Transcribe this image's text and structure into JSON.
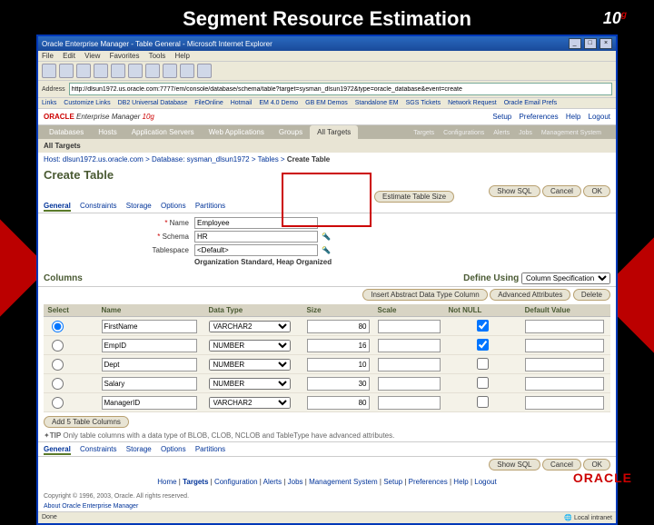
{
  "slide_title": "Segment Resource Estimation",
  "brand_10g": "10",
  "browser": {
    "title": "Oracle Enterprise Manager - Table General - Microsoft Internet Explorer",
    "menu": [
      "File",
      "Edit",
      "View",
      "Favorites",
      "Tools",
      "Help"
    ],
    "addr_label": "Address",
    "addr_url": "http://dlsun1972.us.oracle.com:7777/em/console/database/schema/table?target=sysman_dlsun1972&type=oracle_database&event=create",
    "links_label": "Links",
    "links": [
      "Customize Links",
      "DB2 Universal Database",
      "FileOnline",
      "Hotmail",
      "EM 4.0 Demo",
      "GB EM Demos",
      "Standalone EM",
      "SGS Tickets",
      "Network Request",
      "Oracle Email Prefs"
    ]
  },
  "em": {
    "brand": "ORACLE",
    "product": "Enterprise Manager",
    "ver": "10g",
    "header_links": [
      "Setup",
      "Preferences",
      "Help",
      "Logout"
    ],
    "nav": [
      "Databases",
      "Hosts",
      "Application Servers",
      "Web Applications",
      "Groups"
    ],
    "nav_active": "All Targets",
    "nav_right": [
      "Configurations",
      "Alerts",
      "Jobs",
      "Management System"
    ],
    "subtab_label": "Targets",
    "breadcrumb": {
      "host": "Host: dlsun1972.us.oracle.com",
      "db": "Database: sysman_dlsun1972",
      "tables": "Tables",
      "current": "Create Table"
    }
  },
  "page_title": "Create Table",
  "actions": {
    "show_sql": "Show SQL",
    "cancel": "Cancel",
    "ok": "OK"
  },
  "tabs": [
    "General",
    "Constraints",
    "Storage",
    "Options",
    "Partitions"
  ],
  "form": {
    "name_label": "Name",
    "name_value": "Employee",
    "schema_label": "Schema",
    "schema_value": "HR",
    "ts_label": "Tablespace",
    "ts_value": "<Default>",
    "org_label": "Organization",
    "org_value": "Standard, Heap Organized",
    "lookup_icon": "🔦",
    "estimate": "Estimate Table Size"
  },
  "columns_title": "Columns",
  "define": {
    "label": "Define Using",
    "value": "Column Specification"
  },
  "col_actions": {
    "insert_abs": "Insert Abstract Data Type Column",
    "advanced": "Advanced Attributes",
    "delete": "Delete"
  },
  "headers": {
    "select": "Select",
    "name": "Name",
    "datatype": "Data Type",
    "size": "Size",
    "scale": "Scale",
    "notnull": "Not NULL",
    "default": "Default Value"
  },
  "rows": [
    {
      "name": "FirstName",
      "type": "VARCHAR2",
      "size": "80",
      "scale": "",
      "notnull": true
    },
    {
      "name": "EmpID",
      "type": "NUMBER",
      "size": "16",
      "scale": "",
      "notnull": true
    },
    {
      "name": "Dept",
      "type": "NUMBER",
      "size": "10",
      "scale": "",
      "notnull": false
    },
    {
      "name": "Salary",
      "type": "NUMBER",
      "size": "30",
      "scale": "",
      "notnull": false
    },
    {
      "name": "ManagerID",
      "type": "VARCHAR2",
      "size": "80",
      "scale": "",
      "notnull": false
    }
  ],
  "add5": "Add 5 Table Columns",
  "tip": {
    "label": "TIP",
    "text": "Only table columns with a data type of BLOB, CLOB, NCLOB and TableType have advanced attributes."
  },
  "footer": [
    "Home",
    "Targets",
    "Configuration",
    "Alerts",
    "Jobs",
    "Management System",
    "Setup",
    "Preferences",
    "Help",
    "Logout"
  ],
  "copyright": "Copyright © 1996, 2003, Oracle. All rights reserved.",
  "about": "About Oracle Enterprise Manager",
  "status": {
    "left": "Done",
    "right": "Local intranet"
  },
  "oracle_footer": "ORACLE"
}
